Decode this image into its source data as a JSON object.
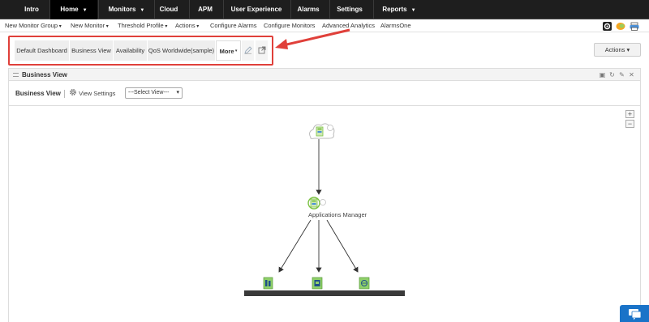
{
  "top_nav": {
    "tabs": [
      {
        "label": "Intro",
        "caret": false,
        "active": false
      },
      {
        "label": "Home",
        "caret": true,
        "active": true
      },
      {
        "label": "Monitors",
        "caret": true,
        "active": false
      },
      {
        "label": "Cloud",
        "caret": false,
        "active": false
      },
      {
        "label": "APM",
        "caret": false,
        "active": false
      },
      {
        "label": "User Experience",
        "caret": false,
        "active": false
      },
      {
        "label": "Alarms",
        "caret": false,
        "active": false
      },
      {
        "label": "Settings",
        "caret": false,
        "active": false
      },
      {
        "label": "Reports",
        "caret": true,
        "active": false
      }
    ]
  },
  "sub_nav": {
    "items": [
      {
        "label": "New Monitor Group",
        "dropdown": true
      },
      {
        "label": "New Monitor",
        "dropdown": true
      },
      {
        "label": "Threshold Profile",
        "dropdown": true
      },
      {
        "label": "Actions",
        "dropdown": true
      },
      {
        "label": "Configure Alarms",
        "dropdown": false
      },
      {
        "label": "Configure Monitors",
        "dropdown": false
      },
      {
        "label": "Advanced Analytics",
        "dropdown": false
      },
      {
        "label": "AlarmsOne",
        "dropdown": false
      }
    ]
  },
  "dashboard_tabs": {
    "tabs": [
      "Default Dashboard",
      "Business View",
      "Availability",
      "QoS Worldwide(sample)",
      "More"
    ],
    "icons": [
      "edit-icon",
      "external-link-icon"
    ]
  },
  "actions_button": {
    "label": "Actions"
  },
  "widget": {
    "title": "Business View",
    "header_icons": [
      "minimize-icon",
      "refresh-icon",
      "edit-icon",
      "close-icon"
    ]
  },
  "business_view": {
    "label": "Business View",
    "settings_label": "View Settings",
    "select_value": "---Select View---"
  },
  "topology": {
    "root_node": "cloud",
    "mid_node_label": "Applications Manager",
    "leaf_count": 3
  },
  "colors": {
    "highlight": "#e0403a",
    "nav_bg": "#1e1e1e",
    "node_green": "#7cc243"
  }
}
